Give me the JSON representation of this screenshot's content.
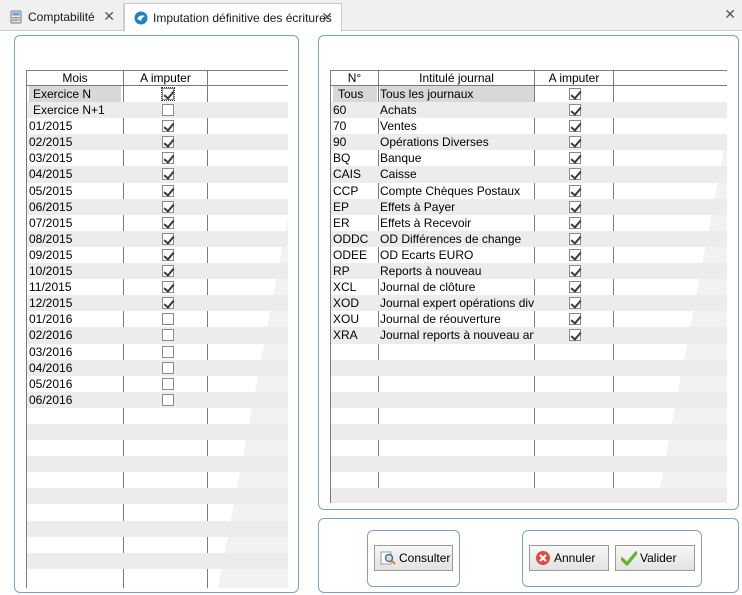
{
  "tabs": [
    {
      "label": "Comptabilité",
      "icon": "calculator-icon",
      "active": false
    },
    {
      "label": "Imputation définitive des écritures",
      "icon": "app-logo-icon",
      "active": true
    }
  ],
  "months_grid": {
    "columns": [
      "Mois",
      "A imputer"
    ],
    "rows": [
      {
        "label": "Exercice N",
        "checked": true
      },
      {
        "label": "Exercice N+1",
        "checked": false
      },
      {
        "label": "01/2015",
        "checked": true
      },
      {
        "label": "02/2015",
        "checked": true
      },
      {
        "label": "03/2015",
        "checked": true
      },
      {
        "label": "04/2015",
        "checked": true
      },
      {
        "label": "05/2015",
        "checked": true
      },
      {
        "label": "06/2015",
        "checked": true
      },
      {
        "label": "07/2015",
        "checked": true
      },
      {
        "label": "08/2015",
        "checked": true
      },
      {
        "label": "09/2015",
        "checked": true
      },
      {
        "label": "10/2015",
        "checked": true
      },
      {
        "label": "11/2015",
        "checked": true
      },
      {
        "label": "12/2015",
        "checked": true
      },
      {
        "label": "01/2016",
        "checked": false
      },
      {
        "label": "02/2016",
        "checked": false
      },
      {
        "label": "03/2016",
        "checked": false
      },
      {
        "label": "04/2016",
        "checked": false
      },
      {
        "label": "05/2016",
        "checked": false
      },
      {
        "label": "06/2016",
        "checked": false
      }
    ]
  },
  "journals_grid": {
    "columns": [
      "N°",
      "Intitulé journal",
      "A imputer"
    ],
    "rows": [
      {
        "code": "Tous",
        "name": "Tous les journaux",
        "checked": true
      },
      {
        "code": "60",
        "name": "Achats",
        "checked": true
      },
      {
        "code": "70",
        "name": "Ventes",
        "checked": true
      },
      {
        "code": "90",
        "name": "Opérations Diverses",
        "checked": true
      },
      {
        "code": "BQ",
        "name": "Banque",
        "checked": true
      },
      {
        "code": "CAIS",
        "name": "Caisse",
        "checked": true
      },
      {
        "code": "CCP",
        "name": "Compte Chèques Postaux",
        "checked": true
      },
      {
        "code": "EP",
        "name": "Effets à Payer",
        "checked": true
      },
      {
        "code": "ER",
        "name": "Effets à Recevoir",
        "checked": true
      },
      {
        "code": "ODDC",
        "name": "OD Différences de change",
        "checked": true
      },
      {
        "code": "ODEE",
        "name": "OD Ecarts EURO",
        "checked": true
      },
      {
        "code": "RP",
        "name": "Reports à nouveau",
        "checked": true
      },
      {
        "code": "XCL",
        "name": "Journal de clôture",
        "checked": true
      },
      {
        "code": "XOD",
        "name": "Journal expert opérations diverses",
        "checked": true
      },
      {
        "code": "XOU",
        "name": "Journal de réouverture",
        "checked": true
      },
      {
        "code": "XRA",
        "name": "Journal reports à nouveau analytique",
        "checked": true
      }
    ]
  },
  "buttons": {
    "consulter": {
      "label": "Consulter",
      "icon": "magnifier-icon"
    },
    "annuler": {
      "label": "Annuler",
      "icon": "red-cross-icon"
    },
    "valider": {
      "label": "Valider",
      "icon": "green-check-icon"
    }
  }
}
